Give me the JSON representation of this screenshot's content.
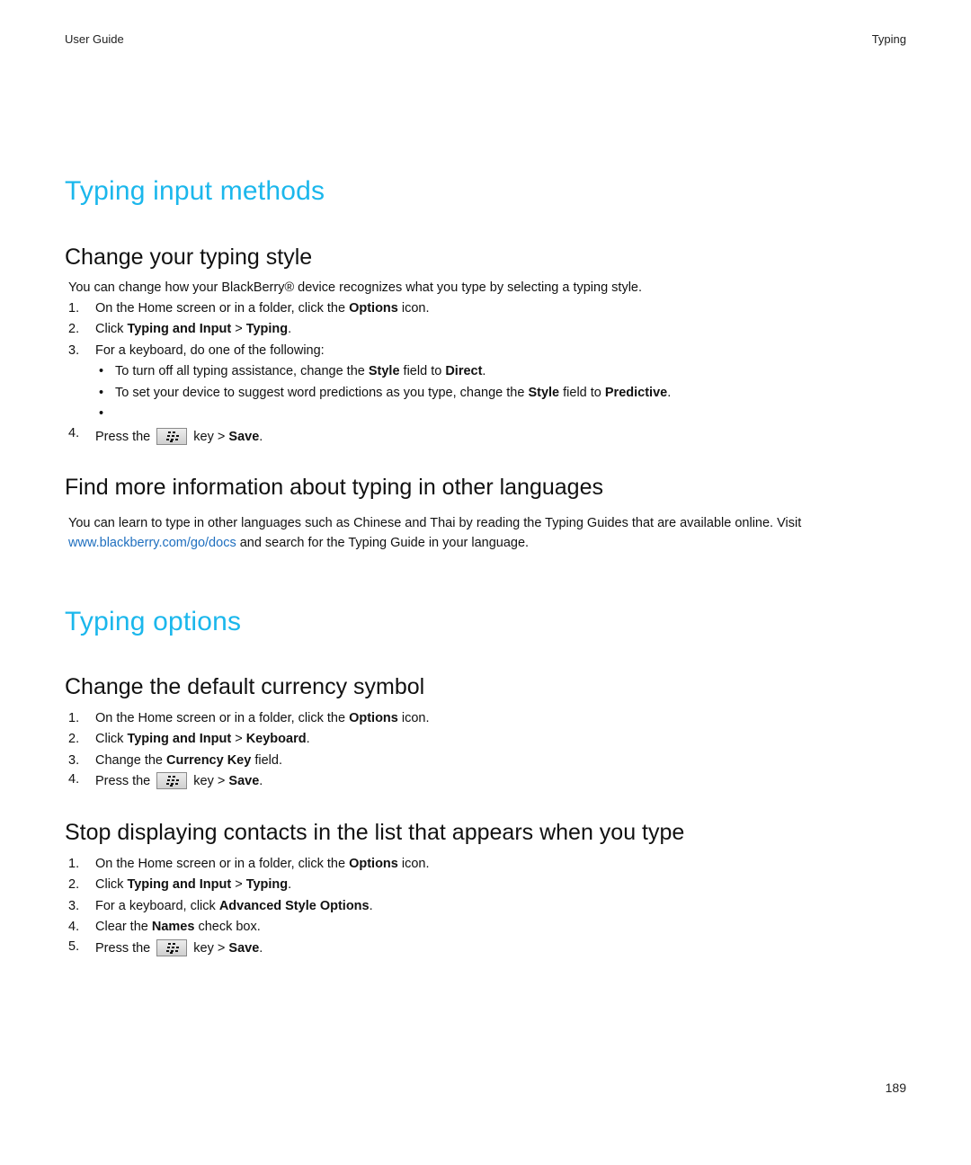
{
  "header": {
    "left": "User Guide",
    "right": "Typing"
  },
  "page_number": "189",
  "brand_colors": {
    "heading_blue": "#1bb7ec",
    "link_blue": "#1f6fbf"
  },
  "sections": [
    {
      "title": "Typing input methods",
      "subsections": [
        {
          "title": "Change your typing style",
          "intro": "You can change how your BlackBerry® device recognizes what you type by selecting a typing style.",
          "steps": [
            {
              "num": "1.",
              "pre": "On the Home screen or in a folder, click the ",
              "b1": "Options",
              "post": " icon."
            },
            {
              "num": "2.",
              "pre": "Click ",
              "b1": "Typing and Input",
              "mid": " > ",
              "b2": "Typing",
              "post": "."
            },
            {
              "num": "3.",
              "pre": "For a keyboard, do one of the following:"
            },
            {
              "num": "4.",
              "pre": "Press the ",
              "key_icon": "blackberry-menu-key-icon",
              "mid": " key > ",
              "b1": "Save",
              "post": "."
            }
          ],
          "bullets": [
            {
              "pre": "To turn off all typing assistance, change the ",
              "b1": "Style",
              "mid": " field to ",
              "b2": "Direct",
              "post": "."
            },
            {
              "pre": "To set your device to suggest word predictions as you type, change the ",
              "b1": "Style",
              "mid": " field to ",
              "b2": "Predictive",
              "post": "."
            },
            {
              "pre": ""
            }
          ],
          "bullet_char": "•"
        },
        {
          "title": "Find more information about typing in other languages",
          "para_line1": "You can learn to type in other languages such as Chinese and Thai by reading the Typing Guides that are available online. Visit",
          "link": "www.blackberry.com/go/docs",
          "para_line2_rest": " and search for the Typing Guide in your language."
        }
      ]
    },
    {
      "title": "Typing options",
      "subsections": [
        {
          "title": "Change the default currency symbol",
          "steps": [
            {
              "num": "1.",
              "pre": "On the Home screen or in a folder, click the ",
              "b1": "Options",
              "post": " icon."
            },
            {
              "num": "2.",
              "pre": "Click ",
              "b1": "Typing and Input",
              "mid": " > ",
              "b2": "Keyboard",
              "post": "."
            },
            {
              "num": "3.",
              "pre": "Change the ",
              "b1": "Currency Key",
              "post": " field."
            },
            {
              "num": "4.",
              "pre": "Press the ",
              "mid": " key > ",
              "b1": "Save",
              "post": "."
            }
          ]
        },
        {
          "title": "Stop displaying contacts in the list that appears when you type",
          "steps": [
            {
              "num": "1.",
              "pre": "On the Home screen or in a folder, click the ",
              "b1": "Options",
              "post": " icon."
            },
            {
              "num": "2.",
              "pre": "Click ",
              "b1": "Typing and Input",
              "mid": " > ",
              "b2": "Typing",
              "post": "."
            },
            {
              "num": "3.",
              "pre": "For a keyboard, click ",
              "b1": "Advanced Style Options",
              "post": "."
            },
            {
              "num": "4.",
              "pre": "Clear the ",
              "b1": "Names",
              "post": " check box."
            },
            {
              "num": "5.",
              "pre": "Press the ",
              "mid": " key > ",
              "b1": "Save",
              "post": "."
            }
          ]
        }
      ]
    }
  ]
}
